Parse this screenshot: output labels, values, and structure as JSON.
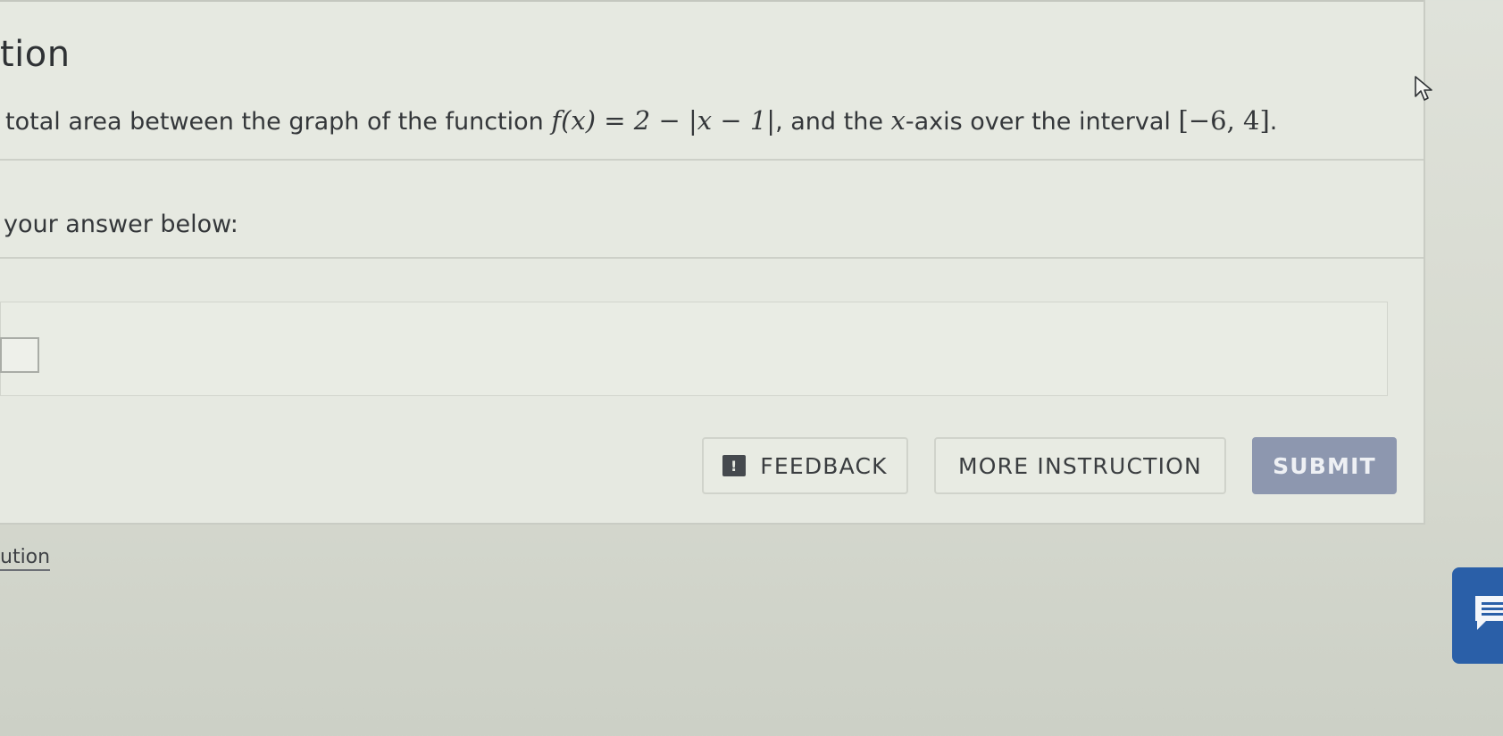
{
  "section": {
    "title": "tion"
  },
  "question": {
    "prompt_lead": "total area between the graph of the function ",
    "function_expr": "f(x) = 2 − |x − 1|",
    "prompt_mid": ", and the ",
    "axis_var": "x",
    "prompt_tail": "-axis over the interval ",
    "interval": "[−6, 4]",
    "prompt_end": "."
  },
  "answer": {
    "label": "your answer below:"
  },
  "buttons": {
    "feedback": "FEEDBACK",
    "feedback_icon": "!",
    "more_instruction": "MORE INSTRUCTION",
    "submit": "SUBMIT"
  },
  "footer": {
    "link_label": "ution"
  },
  "colors": {
    "submit_bg": "#8d97af",
    "chat_widget": "#2a5fa8"
  },
  "icons": {
    "feedback": "feedback-icon",
    "chat": "chat-icon",
    "cursor": "cursor-icon"
  }
}
